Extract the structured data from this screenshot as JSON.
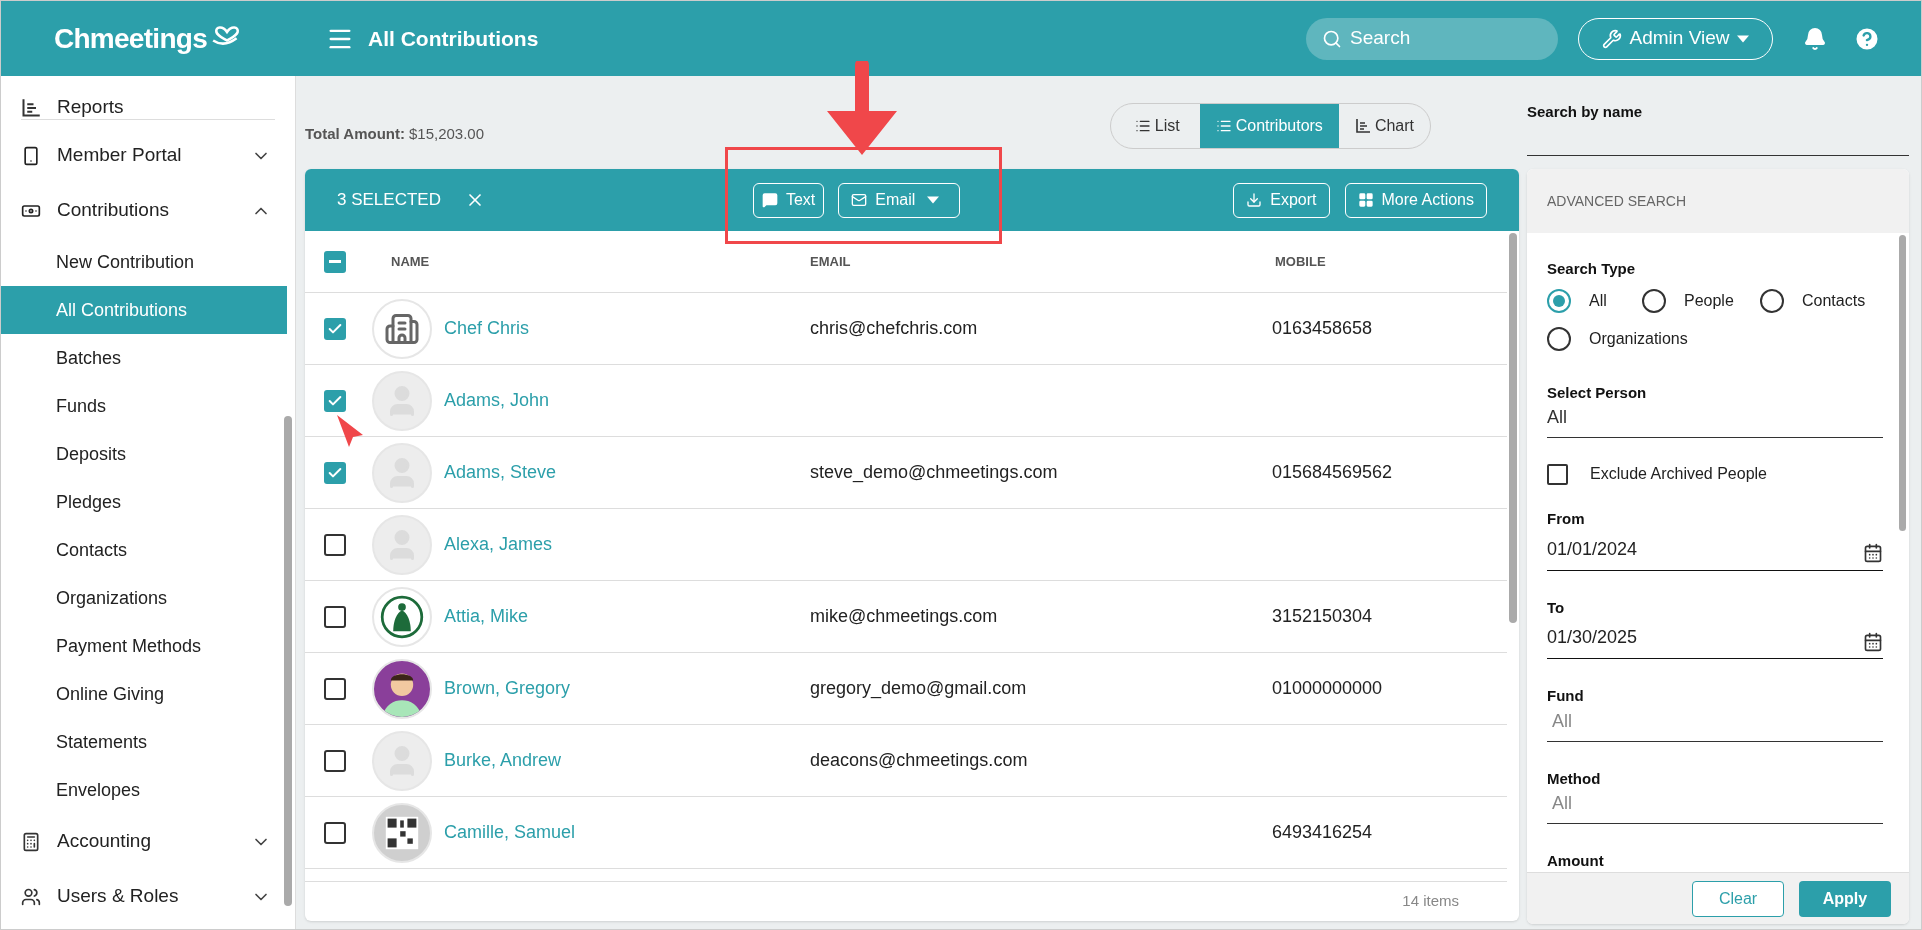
{
  "header": {
    "logo": "Chmeetings",
    "page_title": "All Contributions",
    "search_placeholder": "Search",
    "view_button": "Admin View"
  },
  "sidebar": {
    "items": [
      {
        "label": "Reports"
      },
      {
        "label": "Member Portal",
        "expanded": false
      },
      {
        "label": "Contributions",
        "expanded": true,
        "children": [
          {
            "label": "New Contribution",
            "selected": false
          },
          {
            "label": "All Contributions",
            "selected": true
          },
          {
            "label": "Batches",
            "selected": false
          },
          {
            "label": "Funds",
            "selected": false
          },
          {
            "label": "Deposits",
            "selected": false
          },
          {
            "label": "Pledges",
            "selected": false
          },
          {
            "label": "Contacts",
            "selected": false
          },
          {
            "label": "Organizations",
            "selected": false
          },
          {
            "label": "Payment Methods",
            "selected": false
          },
          {
            "label": "Online Giving",
            "selected": false
          },
          {
            "label": "Statements",
            "selected": false
          },
          {
            "label": "Envelopes",
            "selected": false
          }
        ]
      },
      {
        "label": "Accounting",
        "expanded": false
      },
      {
        "label": "Users & Roles",
        "expanded": false
      }
    ]
  },
  "summary": {
    "total_label": "Total Amount:",
    "total_value": "$15,203.00"
  },
  "view_tabs": [
    {
      "label": "List",
      "selected": false
    },
    {
      "label": "Contributors",
      "selected": true
    },
    {
      "label": "Chart",
      "selected": false
    }
  ],
  "toolbar": {
    "selected_count": "3 SELECTED",
    "actions": [
      "Text",
      "Email"
    ],
    "right_actions": [
      "Export",
      "More Actions"
    ]
  },
  "table": {
    "partially_selected": true,
    "columns": [
      "NAME",
      "EMAIL",
      "MOBILE"
    ],
    "rows": [
      {
        "checked": true,
        "avatar": {
          "kind": "building"
        },
        "name": "Chef Chris",
        "email": "chris@chefchris.com",
        "mobile": "0163458658"
      },
      {
        "checked": true,
        "avatar": {
          "kind": "default"
        },
        "name": "Adams, John"
      },
      {
        "checked": true,
        "avatar": {
          "kind": "default"
        },
        "name": "Adams, Steve",
        "email": "steve_demo@chmeetings.com",
        "mobile": "015684569562"
      },
      {
        "checked": false,
        "avatar": {
          "kind": "default"
        },
        "name": "Alexa, James"
      },
      {
        "checked": false,
        "avatar": {
          "kind": "emblem"
        },
        "name": "Attia, Mike",
        "email": "mike@chmeetings.com",
        "mobile": "3152150304"
      },
      {
        "checked": false,
        "avatar": {
          "kind": "person"
        },
        "name": "Brown, Gregory",
        "email": "gregory_demo@gmail.com",
        "mobile": "01000000000"
      },
      {
        "checked": false,
        "avatar": {
          "kind": "default"
        },
        "name": "Burke, Andrew",
        "email": "deacons@chmeetings.com"
      },
      {
        "checked": false,
        "avatar": {
          "kind": "code"
        },
        "name": "Camille, Samuel",
        "mobile": "6493416254"
      }
    ],
    "footer": "14 items"
  },
  "search_panel": {
    "search_label": "Search by name",
    "title": "ADVANCED SEARCH",
    "search_type_label": "Search Type",
    "search_types": [
      {
        "label": "All",
        "selected": true
      },
      {
        "label": "People",
        "selected": false
      },
      {
        "label": "Contacts",
        "selected": false
      },
      {
        "label": "Organizations",
        "selected": false
      }
    ],
    "filters": [
      {
        "kind": "select",
        "label": "Select Person",
        "value": "All"
      },
      {
        "kind": "checkbox",
        "label": "Exclude Archived People",
        "checked": false
      },
      {
        "kind": "date",
        "label": "From",
        "value": "01/01/2024"
      },
      {
        "kind": "date",
        "label": "To",
        "value": "01/30/2025"
      },
      {
        "kind": "select",
        "label": "Fund",
        "placeholder": "All"
      },
      {
        "kind": "select",
        "label": "Method",
        "placeholder": "All"
      },
      {
        "kind": "heading",
        "label": "Amount"
      }
    ],
    "buttons": [
      "Clear",
      "Apply"
    ]
  }
}
